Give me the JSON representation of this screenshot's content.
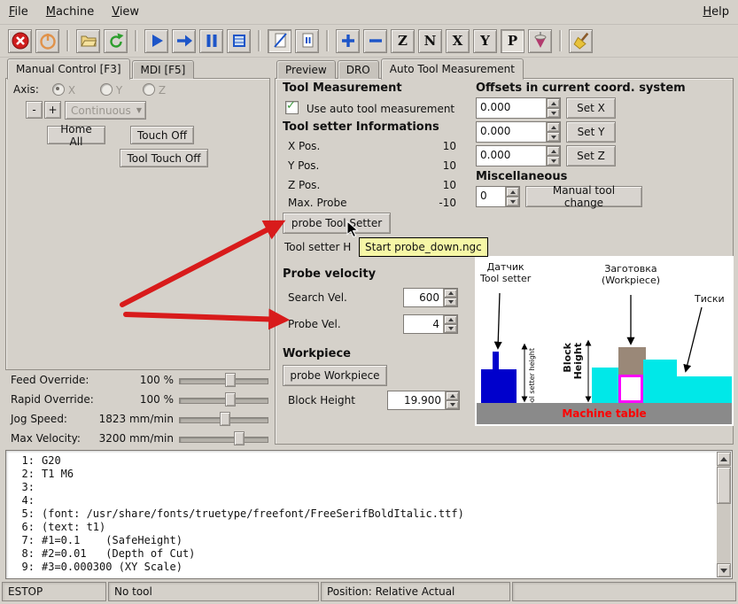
{
  "menu": {
    "file": "File",
    "machine": "Machine",
    "view": "View",
    "help": "Help"
  },
  "toolbar": {
    "icons": [
      "estop",
      "machine-power",
      "open-file",
      "reload-file",
      "run",
      "step",
      "pause",
      "stop",
      "toggle-skip-lines",
      "toggle-optional-pause",
      "zoom-in",
      "zoom-out",
      "view-z",
      "view-z-rotated",
      "view-x",
      "view-y",
      "view-p",
      "rotate-view",
      "clear-plot"
    ],
    "view_letters": {
      "z": "Z",
      "n": "N",
      "x": "X",
      "y": "Y",
      "p": "P"
    }
  },
  "left_panel": {
    "tabs": {
      "manual": "Manual Control [F3]",
      "mdi": "MDI [F5]"
    },
    "axis_label": "Axis:",
    "axes": {
      "x": "X",
      "y": "Y",
      "z": "Z"
    },
    "jog_minus": "-",
    "jog_plus": "+",
    "jog_mode": "Continuous",
    "home_all": "Home All",
    "touch_off": "Touch Off",
    "tool_touch_off": "Tool Touch Off",
    "overrides": [
      {
        "label": "Feed Override:",
        "value": "100 %"
      },
      {
        "label": "Rapid Override:",
        "value": "100 %"
      },
      {
        "label": "Jog Speed:",
        "value": "1823 mm/min"
      },
      {
        "label": "Max Velocity:",
        "value": "3200 mm/min"
      }
    ]
  },
  "right_panel": {
    "tabs": {
      "preview": "Preview",
      "dro": "DRO",
      "auto": "Auto Tool Measurement"
    },
    "tool_measurement": {
      "title": "Tool Measurement",
      "use_auto_label": "Use auto tool measurement",
      "info_title": "Tool setter Informations",
      "info_rows": [
        {
          "label": "X Pos.",
          "value": "10"
        },
        {
          "label": "Y Pos.",
          "value": "10"
        },
        {
          "label": "Z Pos.",
          "value": "10"
        },
        {
          "label": "Max. Probe",
          "value": "-10"
        }
      ],
      "probe_tool_setter": "probe Tool Setter",
      "tool_setter_height_label": "Tool setter H",
      "probe_velocity_title": "Probe velocity",
      "search_vel_label": "Search Vel.",
      "search_vel": "600",
      "probe_vel_label": "Probe Vel.",
      "probe_vel": "4",
      "workpiece_title": "Workpiece",
      "probe_workpiece": "probe Workpiece",
      "block_height_label": "Block Height",
      "block_height": "19.900"
    },
    "offsets": {
      "title": "Offsets in current coord. system",
      "rows": [
        {
          "value": "0.000",
          "button": "Set X"
        },
        {
          "value": "0.000",
          "button": "Set Y"
        },
        {
          "value": "0.000",
          "button": "Set Z"
        }
      ]
    },
    "misc": {
      "title": "Miscellaneous",
      "value": "0",
      "button": "Manual tool change"
    },
    "diagram": {
      "sensor_label_1": "Датчик",
      "sensor_label_2": "Tool setter",
      "workpiece_label_1": "Заготовка",
      "workpiece_label_2": "(Workpiece)",
      "vise_label": "Тиски",
      "block_height_1": "Block",
      "block_height_2": "Height",
      "tool_setter_height": "Tool setter height",
      "machine_table": "Machine table"
    }
  },
  "tooltip": "Start probe_down.ngc",
  "gcode": {
    "lines": [
      {
        "n": "1:",
        "t": "G20"
      },
      {
        "n": "2:",
        "t": "T1 M6"
      },
      {
        "n": "3:",
        "t": ""
      },
      {
        "n": "4:",
        "t": ""
      },
      {
        "n": "5:",
        "t": "(font: /usr/share/fonts/truetype/freefont/FreeSerifBoldItalic.ttf)"
      },
      {
        "n": "6:",
        "t": "(text: t1)"
      },
      {
        "n": "7:",
        "t": "#1=0.1    (SafeHeight)"
      },
      {
        "n": "8:",
        "t": "#2=0.01   (Depth of Cut)"
      },
      {
        "n": "9:",
        "t": "#3=0.000300 (XY Scale)"
      }
    ]
  },
  "statusbar": {
    "estop": "ESTOP",
    "tool": "No tool",
    "position": "Position: Relative Actual"
  },
  "colors": {
    "annotation_arrow": "#d81b1b",
    "tooltip_bg": "#f6f7a6",
    "machine_table_text": "#ff0000",
    "tool_setter_blue": "#0000cc",
    "vise_cyan": "#00e8e8",
    "workpiece_magenta": "#ff00ff"
  }
}
